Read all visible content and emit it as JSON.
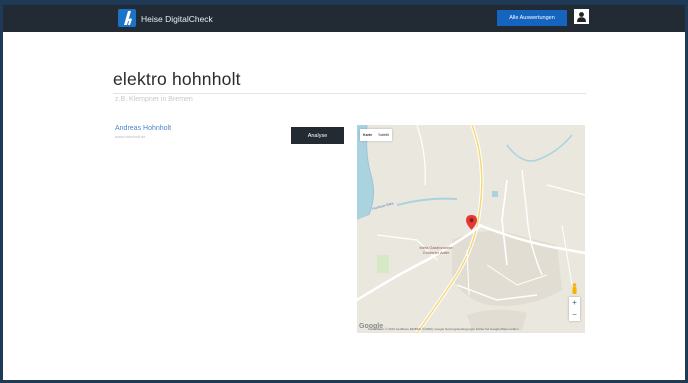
{
  "header": {
    "brand": "Heise DigitalCheck",
    "nav_button": "Alle Auswertungen",
    "user_icon": "user-icon",
    "bg_color": "#222a33",
    "accent_color": "#1565c0"
  },
  "page": {
    "title": "elektro hohnholt",
    "subtitle": "z.B. Klempner in Bremen"
  },
  "contact": {
    "name": "Andreas Hohnholt",
    "url": "www.hohnholt.de"
  },
  "analyse_button": "Analyse",
  "map": {
    "toggle": [
      "Karte",
      "Satellit"
    ],
    "places": {
      "gastronomie": "Meta Gastronomie\nGoldener Adler"
    },
    "water_labels": [
      "Huntloser Bäke"
    ],
    "zoom_in": "+",
    "zoom_out": "−",
    "google_logo": "Google",
    "attribution": "Kartendaten © 2016 GeoBasis-DE/BKG (©2009), Google   Nutzungsbedingungen   Fehler bei Google Maps melden",
    "pin_color": "#e53935"
  }
}
